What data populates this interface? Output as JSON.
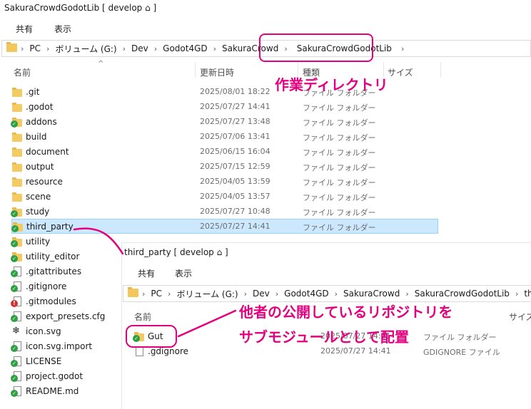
{
  "main": {
    "title": "SakuraCrowdGodotLib [ develop ⌂ ]",
    "ribbon": [
      "共有",
      "表示"
    ],
    "breadcrumb": [
      "PC",
      "ボリューム (G:)",
      "Dev",
      "Godot4GD",
      "SakuraCrowd",
      "SakuraCrowdGodotLib"
    ],
    "columns": {
      "name": "名前",
      "date": "更新日時",
      "type": "種類",
      "size": "サイズ"
    },
    "rows": [
      {
        "name": ".git",
        "date": "2025/08/01 18:22",
        "type": "ファイル フォルダー",
        "icon": "folder",
        "badge": ""
      },
      {
        "name": ".godot",
        "date": "2025/07/27 14:41",
        "type": "ファイル フォルダー",
        "icon": "folder",
        "badge": ""
      },
      {
        "name": "addons",
        "date": "2025/07/27 13:48",
        "type": "ファイル フォルダー",
        "icon": "folder",
        "badge": "ok"
      },
      {
        "name": "build",
        "date": "2025/07/06 13:41",
        "type": "ファイル フォルダー",
        "icon": "folder",
        "badge": ""
      },
      {
        "name": "document",
        "date": "2025/06/15 16:04",
        "type": "ファイル フォルダー",
        "icon": "folder",
        "badge": ""
      },
      {
        "name": "output",
        "date": "2025/07/15 12:59",
        "type": "ファイル フォルダー",
        "icon": "folder",
        "badge": ""
      },
      {
        "name": "resource",
        "date": "2025/04/05 13:59",
        "type": "ファイル フォルダー",
        "icon": "folder",
        "badge": ""
      },
      {
        "name": "scene",
        "date": "2025/04/05 13:57",
        "type": "ファイル フォルダー",
        "icon": "folder",
        "badge": ""
      },
      {
        "name": "study",
        "date": "2025/07/27 10:48",
        "type": "ファイル フォルダー",
        "icon": "folder",
        "badge": "ok"
      },
      {
        "name": "third_party",
        "date": "2025/07/27 14:41",
        "type": "ファイル フォルダー",
        "icon": "folder",
        "badge": "ok"
      },
      {
        "name": "utility",
        "date": "",
        "type": "",
        "icon": "folder",
        "badge": "ok"
      },
      {
        "name": "utility_editor",
        "date": "",
        "type": "",
        "icon": "folder",
        "badge": "ok"
      },
      {
        "name": ".gitattributes",
        "date": "",
        "type": "",
        "icon": "file",
        "badge": "ok"
      },
      {
        "name": ".gitignore",
        "date": "",
        "type": "",
        "icon": "file",
        "badge": "ok"
      },
      {
        "name": ".gitmodules",
        "date": "",
        "type": "",
        "icon": "file",
        "badge": "mod"
      },
      {
        "name": "export_presets.cfg",
        "date": "",
        "type": "",
        "icon": "file",
        "badge": "ok"
      },
      {
        "name": "icon.svg",
        "date": "",
        "type": "",
        "icon": "svg",
        "badge": ""
      },
      {
        "name": "icon.svg.import",
        "date": "",
        "type": "",
        "icon": "file",
        "badge": "ok"
      },
      {
        "name": "LICENSE",
        "date": "",
        "type": "",
        "icon": "file",
        "badge": "ok"
      },
      {
        "name": "project.godot",
        "date": "",
        "type": "",
        "icon": "file",
        "badge": "ok"
      },
      {
        "name": "README.md",
        "date": "",
        "type": "",
        "icon": "file",
        "badge": "ok"
      }
    ]
  },
  "sub": {
    "title": "third_party [ develop ⌂ ]",
    "ribbon": [
      "共有",
      "表示"
    ],
    "breadcrumb": [
      "PC",
      "ボリューム (G:)",
      "Dev",
      "Godot4GD",
      "SakuraCrowd",
      "SakuraCrowdGodotLib",
      "third_party"
    ],
    "columns": {
      "name": "名前",
      "size": "サイズ"
    },
    "rows": [
      {
        "name": "Gut",
        "date": "2025/07/27 14:41",
        "type": "ファイル フォルダー",
        "icon": "folder",
        "badge": "ok"
      },
      {
        "name": ".gdignore",
        "date": "2025/07/27 14:41",
        "type": "GDIGNORE ファイル",
        "icon": "file",
        "badge": ""
      }
    ]
  },
  "annotations": {
    "work_dir": "作業ディレクトリ",
    "submodule_line1": "他者の公開しているリポジトリを",
    "submodule_line2": "サブモジュールとして配置"
  },
  "colors": {
    "accent": "#e4007f",
    "selection": "#cce8ff",
    "folder": "#f4cb62",
    "badge_ok": "#2ea043",
    "badge_mod": "#d32f2f"
  }
}
